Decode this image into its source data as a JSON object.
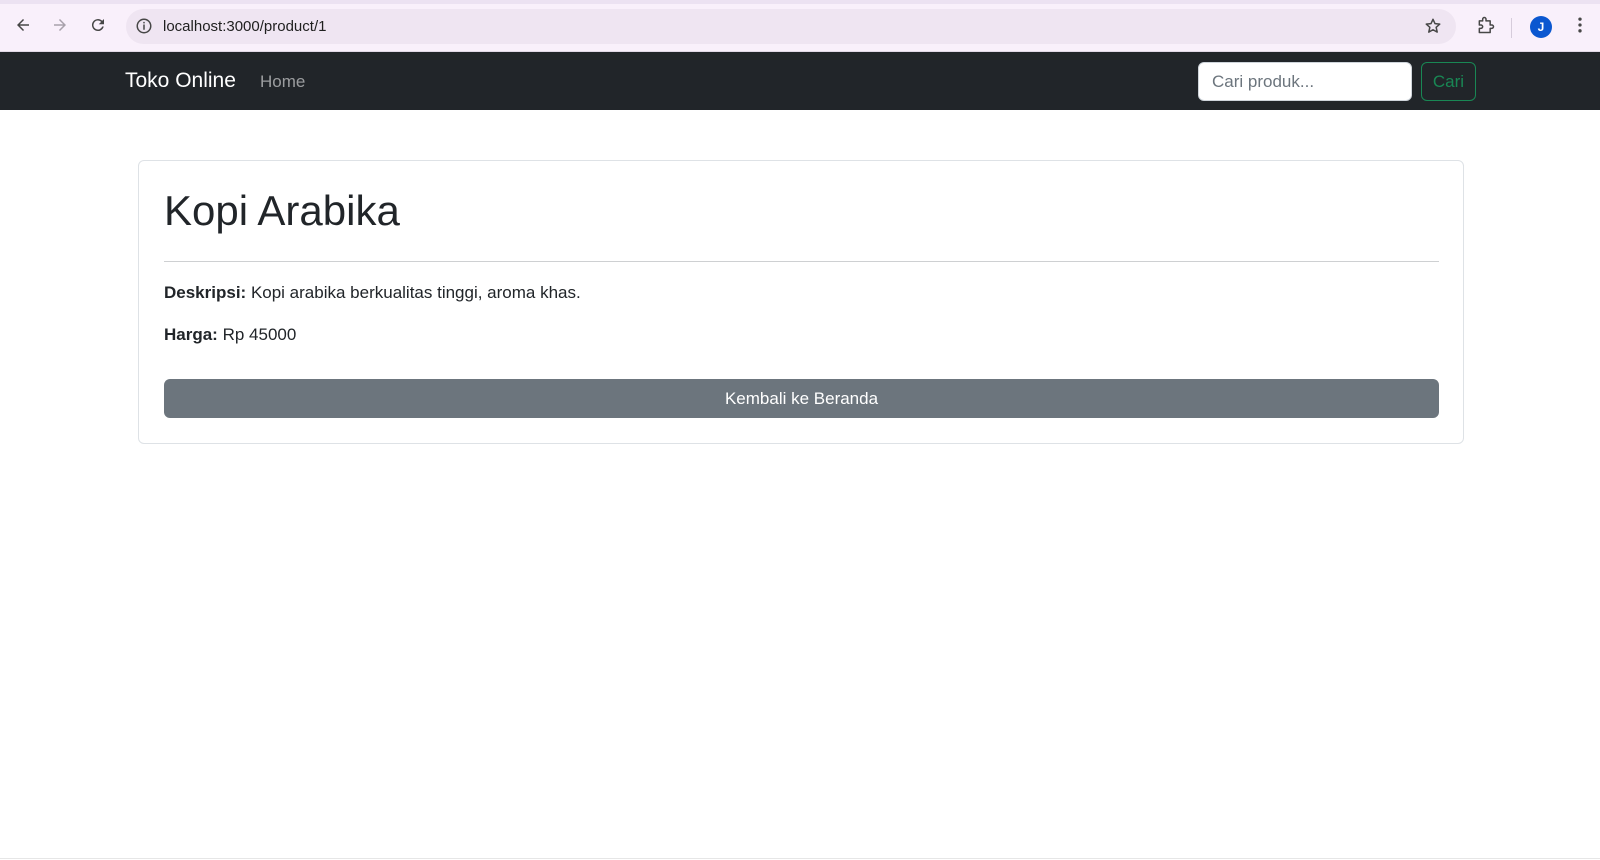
{
  "browser": {
    "url": "localhost:3000/product/1",
    "profile_initial": "J",
    "icons": [
      "back-arrow-icon",
      "forward-arrow-icon",
      "reload-icon",
      "site-info-icon",
      "bookmark-star-icon",
      "extensions-puzzle-icon",
      "kebab-menu-icon"
    ]
  },
  "navbar": {
    "brand": "Toko Online",
    "home_link": "Home",
    "search_placeholder": "Cari produk...",
    "search_button": "Cari",
    "colors": {
      "background": "#212529",
      "search_button": "#198754"
    }
  },
  "product": {
    "name": "Kopi Arabika",
    "description_label": "Deskripsi:",
    "description": "Kopi arabika berkualitas tinggi, aroma khas.",
    "price_label": "Harga:",
    "price": "Rp 45000",
    "back_button": "Kembali ke Beranda",
    "colors": {
      "back_button": "#6c757d"
    }
  }
}
